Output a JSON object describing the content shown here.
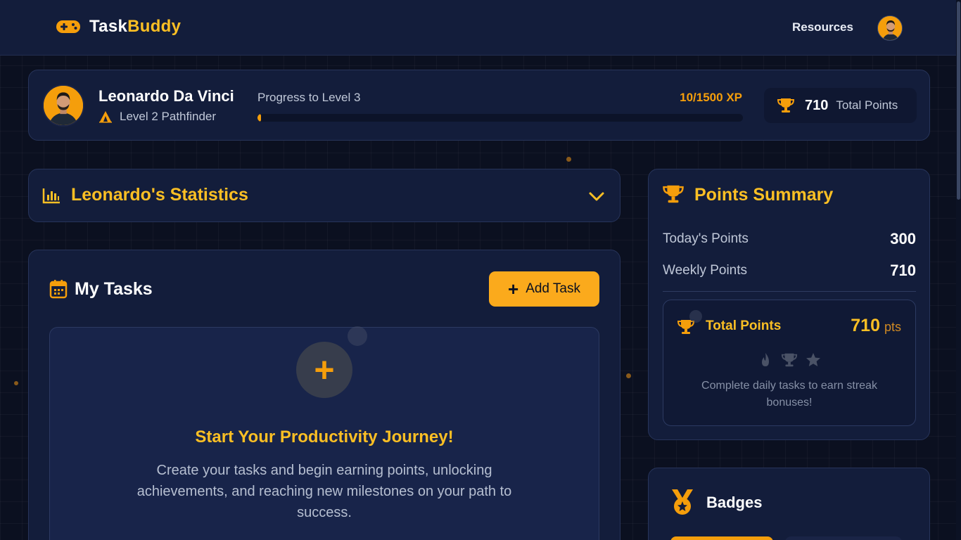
{
  "app": {
    "name_part1": "Task",
    "name_part2": "Buddy"
  },
  "nav": {
    "resources_label": "Resources"
  },
  "profile": {
    "name": "Leonardo Da Vinci",
    "level": "Level 2 Pathfinder",
    "progress_label": "Progress to Level 3",
    "xp_text": "10/1500 XP",
    "progress_fraction": 0.0067,
    "total_points_value": "710",
    "total_points_label": "Total Points"
  },
  "statistics": {
    "title": "Leonardo's Statistics"
  },
  "tasks": {
    "title": "My Tasks",
    "add_button_label": "Add Task",
    "empty_title": "Start Your Productivity Journey!",
    "empty_description": "Create your tasks and begin earning points, unlocking achievements, and reaching new milestones on your path to success."
  },
  "points_summary": {
    "title": "Points Summary",
    "rows": [
      {
        "label": "Today's Points",
        "value": "300"
      },
      {
        "label": "Weekly Points",
        "value": "710"
      }
    ],
    "total_label": "Total Points",
    "total_value": "710",
    "total_unit": "pts",
    "streak_text": "Complete daily tasks to earn streak bonuses!"
  },
  "badges": {
    "title": "Badges"
  },
  "icons": {
    "logo": "gamepad-icon",
    "level": "tent-icon",
    "points": "trophy-icon",
    "statistics": "bar-chart-icon",
    "expand": "chevron-down-icon",
    "tasks": "calendar-icon",
    "streak": [
      "fire-icon",
      "trophy-icon",
      "star-icon"
    ],
    "badges": "medal-icon"
  },
  "colors": {
    "accent": "#f59e0b",
    "accent_bright": "#fbbf24",
    "background": "#0b1020",
    "card": "#131d3b"
  }
}
